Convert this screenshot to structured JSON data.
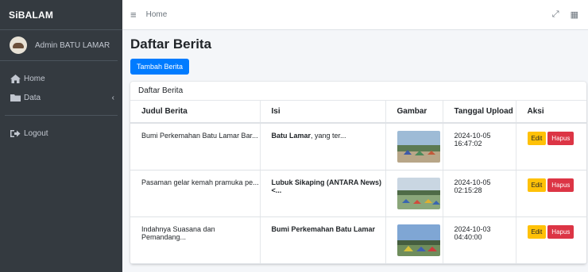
{
  "brand": "SiBALAM",
  "user": {
    "name": "Admin BATU LAMAR"
  },
  "sidebar": {
    "items": [
      {
        "label": "Home",
        "icon": "home-icon"
      },
      {
        "label": "Data",
        "icon": "folder-icon",
        "caret": "‹"
      },
      {
        "label": "Logout",
        "icon": "sign-out-icon"
      }
    ]
  },
  "navbar": {
    "menu_icon": "≡",
    "home": "Home",
    "expand_icon": "⤢",
    "grid_icon": "▦"
  },
  "page": {
    "title": "Daftar Berita",
    "add_button": "Tambah Berita"
  },
  "card": {
    "title": "Daftar Berita"
  },
  "table": {
    "headers": [
      "Judul Berita",
      "Isi",
      "Gambar",
      "Tanggal Upload",
      "Aksi"
    ],
    "rows": [
      {
        "judul": "Bumi Perkemahan Batu Lamar Bar...",
        "isi_bold": "Batu Lamar",
        "isi_rest": ", yang ter...",
        "tanggal": "2024-10-05 16:47:02"
      },
      {
        "judul": "Pasaman gelar kemah pramuka pe...",
        "isi_bold": "Lubuk Sikaping (ANTARA News)<...",
        "isi_rest": "",
        "tanggal": "2024-10-05 02:15:28"
      },
      {
        "judul": "Indahnya Suasana dan Pemandang...",
        "isi_bold": "Bumi Perkemahan Batu Lamar",
        "isi_rest": "",
        "tanggal": "2024-10-03 04:40:00"
      }
    ],
    "edit_label": "Edit",
    "delete_label": "Hapus"
  },
  "colors": {
    "sidebar_bg": "#343a40",
    "primary": "#007bff",
    "warning": "#ffc107",
    "danger": "#dc3545"
  }
}
